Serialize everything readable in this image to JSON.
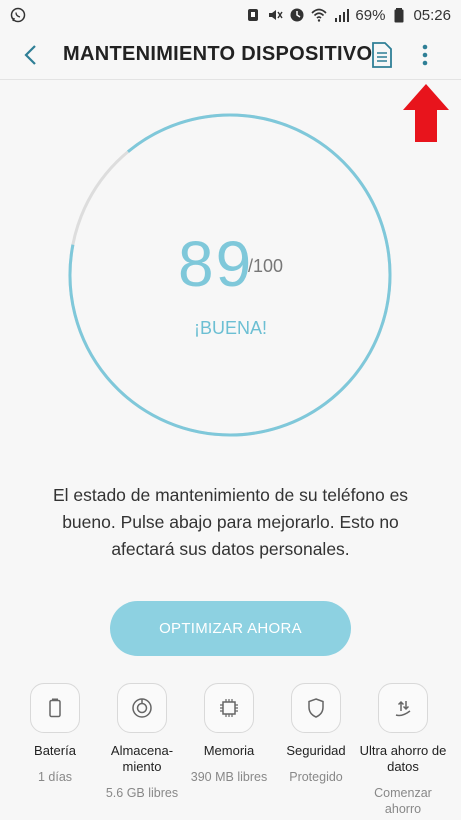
{
  "status_bar": {
    "battery_percent": "69%",
    "time": "05:26",
    "icons": [
      "whatsapp-icon",
      "alarm-icon",
      "mute-icon",
      "clock-icon",
      "wifi-icon",
      "signal-icon",
      "battery-icon"
    ]
  },
  "header": {
    "title": "MANTENIMIENTO DISPOSITIVO",
    "icons": [
      "back-icon",
      "document-icon",
      "more-vert-icon"
    ]
  },
  "score": {
    "value": "89",
    "total": "/100",
    "status": "¡BUENA!",
    "fraction": 0.89
  },
  "description": "El estado de mantenimiento de su teléfono es bueno. Pulse abajo para mejorarlo. Esto no afectará sus datos personales.",
  "optimize_button": "OPTIMIZAR AHORA",
  "categories": [
    {
      "label": "Batería",
      "sub": "1 días",
      "icon": "battery-icon"
    },
    {
      "label": "Almacena-\nmiento",
      "sub": "5.6 GB libres",
      "icon": "storage-icon"
    },
    {
      "label": "Memoria",
      "sub": "390 MB libres",
      "icon": "memory-chip-icon"
    },
    {
      "label": "Seguridad",
      "sub": "Protegido",
      "icon": "shield-icon"
    },
    {
      "label": "Ultra ahorro de datos",
      "sub": "Comenzar ahorro",
      "icon": "data-saver-icon"
    }
  ],
  "colors": {
    "accent": "#7fc8da",
    "button": "#8dd1e1",
    "gauge_track": "#dddddd",
    "arrow": "#e8141c"
  }
}
